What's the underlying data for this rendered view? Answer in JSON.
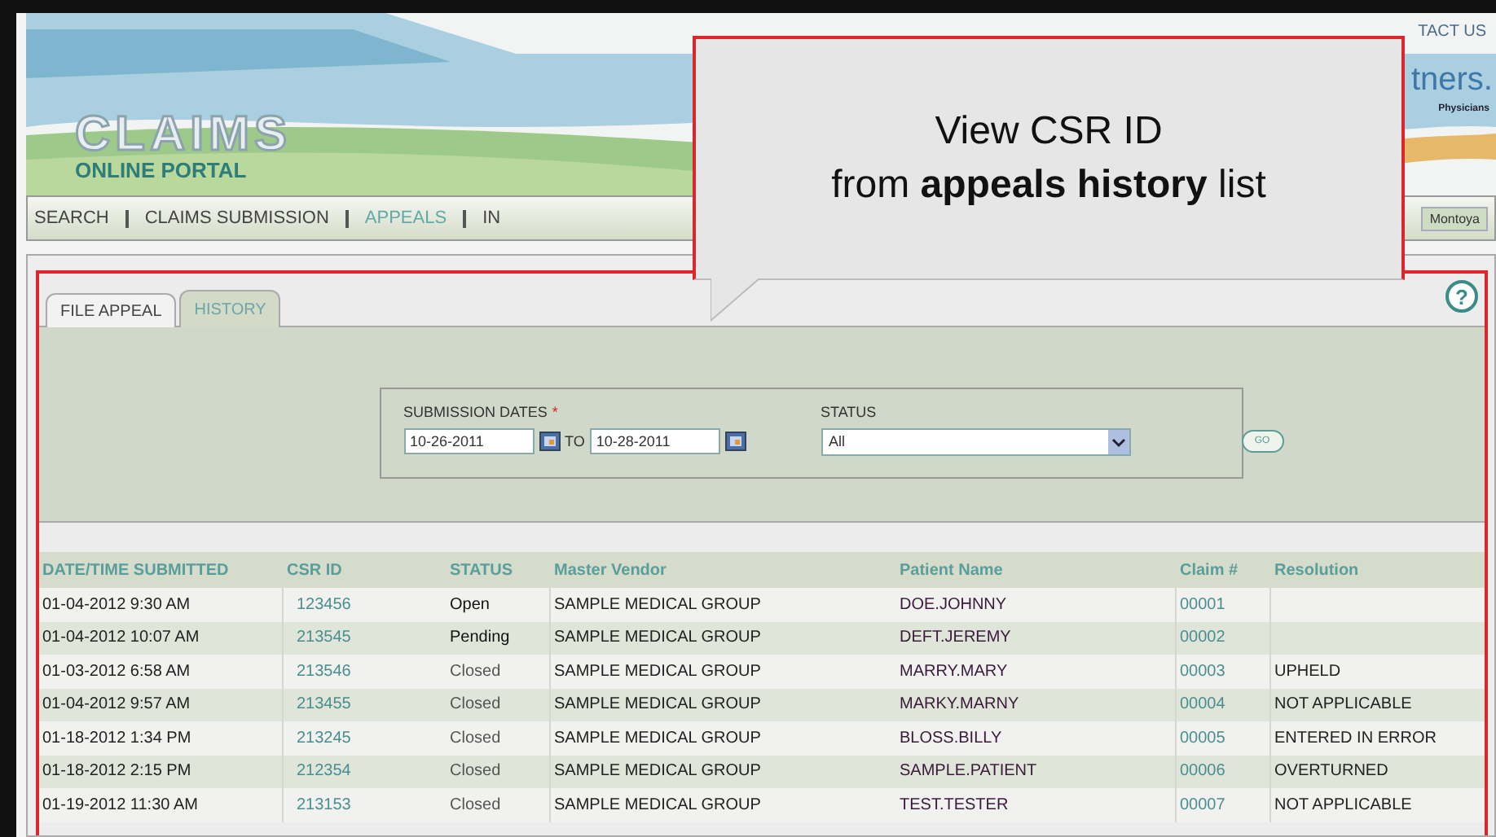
{
  "header": {
    "top_link": "TACT US",
    "logo_title": "CLAIMS",
    "logo_subtitle": "ONLINE PORTAL",
    "partner_logo": "tners.",
    "partner_tagline": "Physicians",
    "user": "Montoya"
  },
  "nav": [
    {
      "label": "SEARCH",
      "selected": false
    },
    {
      "label": "CLAIMS SUBMISSION",
      "selected": false
    },
    {
      "label": "APPEALS",
      "selected": true
    },
    {
      "label": "IN",
      "selected": false
    }
  ],
  "callout": {
    "line_1": "View CSR ID",
    "line_2": "from **appeals history** list"
  },
  "tabs": [
    {
      "label": "FILE APPEAL",
      "selected": false
    },
    {
      "label": "HISTORY",
      "selected": true
    }
  ],
  "help": "?",
  "filter": {
    "dates_label": "SUBMISSION DATES",
    "required_mark": "*",
    "from_date": "10-26-2011",
    "to_label": "TO",
    "to_date": "10-28-2011",
    "status_label": "STATUS",
    "status_value": "All",
    "go": "GO"
  },
  "table": {
    "columns": [
      "DATE/TIME SUBMITTED",
      "CSR ID",
      "STATUS",
      "Master Vendor",
      "Patient Name",
      "Claim #",
      "Resolution"
    ],
    "rows": [
      [
        "01-04-2012 9:30 AM",
        "123456",
        "Open",
        "SAMPLE MEDICAL GROUP",
        "DOE.JOHNNY",
        "00001",
        ""
      ],
      [
        "01-04-2012 10:07 AM",
        "213545",
        "Pending",
        "SAMPLE MEDICAL GROUP",
        "DEFT.JEREMY",
        "00002",
        ""
      ],
      [
        "01-03-2012 6:58 AM",
        "213546",
        "Closed",
        "SAMPLE MEDICAL GROUP",
        "MARRY.MARY",
        "00003",
        "UPHELD"
      ],
      [
        "01-04-2012 9:57 AM",
        "213455",
        "Closed",
        "SAMPLE MEDICAL GROUP",
        "MARKY.MARNY",
        "00004",
        "NOT APPLICABLE"
      ],
      [
        "01-18-2012 1:34 PM",
        "213245",
        "Closed",
        "SAMPLE MEDICAL GROUP",
        "BLOSS.BILLY",
        "00005",
        "ENTERED IN ERROR"
      ],
      [
        "01-18-2012 2:15 PM",
        "212354",
        "Closed",
        "SAMPLE MEDICAL GROUP",
        "SAMPLE.PATIENT",
        "00006",
        "OVERTURNED"
      ],
      [
        "01-19-2012 11:30 AM",
        "213153",
        "Closed",
        "SAMPLE MEDICAL GROUP",
        "TEST.TESTER",
        "00007",
        "NOT APPLICABLE"
      ]
    ]
  }
}
